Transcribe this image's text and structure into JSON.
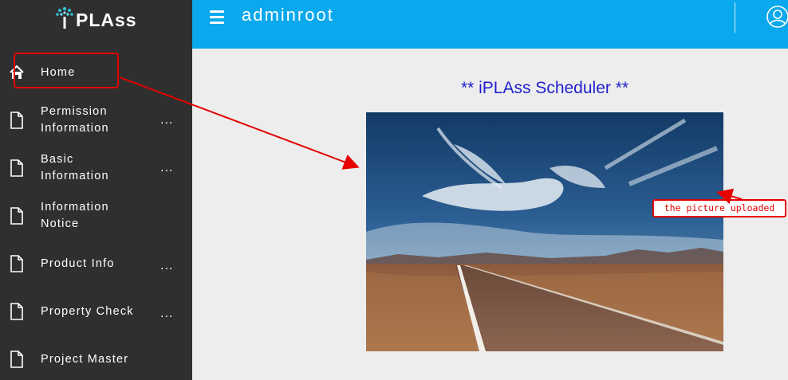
{
  "brand": {
    "logo_text": "PLAss",
    "logo_letter": "i"
  },
  "sidebar": {
    "items": [
      {
        "label": "Home",
        "icon": "home-icon",
        "more": ""
      },
      {
        "label": "Permission\nInformation",
        "icon": "document-icon",
        "more": "..."
      },
      {
        "label": "Basic\nInformation",
        "icon": "document-icon",
        "more": "..."
      },
      {
        "label": "Information\nNotice",
        "icon": "document-icon",
        "more": ""
      },
      {
        "label": "Product Info",
        "icon": "document-icon",
        "more": "..."
      },
      {
        "label": "Property Check",
        "icon": "document-icon",
        "more": "..."
      },
      {
        "label": "Project Master",
        "icon": "document-icon",
        "more": ""
      }
    ]
  },
  "header": {
    "user_name": "adminroot",
    "menu_icon": "hamburger-icon",
    "user_icon": "user-icon"
  },
  "main": {
    "title": "** iPLAss Scheduler **",
    "picture": "desert-road-photo"
  },
  "annotation": {
    "label": "the picture uploaded",
    "color": "#e60000"
  },
  "colors": {
    "sidebar_bg": "#2f2f2f",
    "header_bg": "#0aa8ec",
    "title_color": "#1f1fcf"
  }
}
